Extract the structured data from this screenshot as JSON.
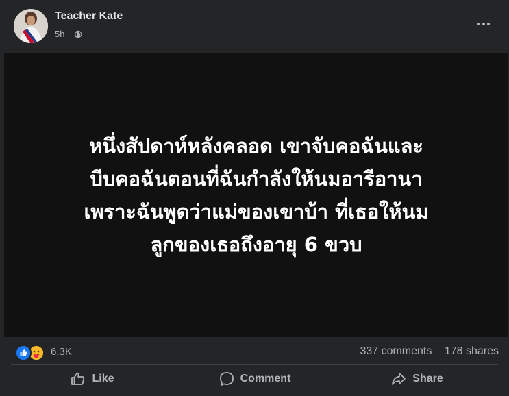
{
  "author": {
    "name": "Teacher Kate",
    "time": "5h",
    "separator": "·",
    "audience_icon": "globe-icon"
  },
  "header": {
    "more_icon": "more-options-icon"
  },
  "post": {
    "text_lines": [
      "หนึ่งสัปดาห์หลังคลอด เขาจับคอฉันและ",
      "บีบคอฉันตอนที่ฉันกำลังให้นมอารีอานา",
      "เพราะฉันพูดว่าแม่ของเขาบ้า ที่เธอให้นม",
      "ลูกของเธอถึงอายุ 6 ขวบ"
    ],
    "background_color": "#111111",
    "text_color": "#ffffff"
  },
  "reactions": {
    "icons": [
      "like-reaction-icon",
      "care-reaction-icon"
    ],
    "count": "6.3K"
  },
  "stats": {
    "comments": "337 comments",
    "shares": "178 shares"
  },
  "actions": {
    "like": "Like",
    "comment": "Comment",
    "share": "Share"
  },
  "colors": {
    "card": "#242526",
    "secondary_text": "#b0b3b8",
    "like_blue": "#1877f2"
  }
}
